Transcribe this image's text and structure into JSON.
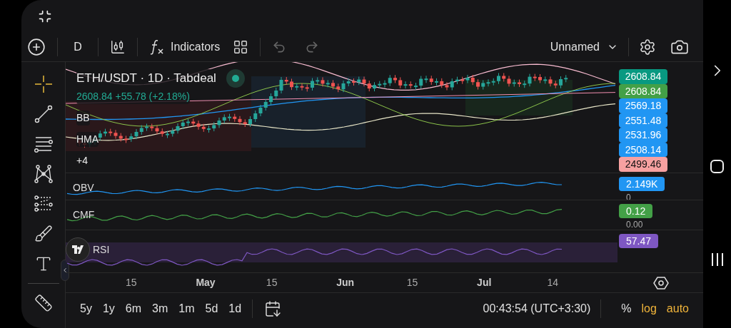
{
  "toolbar": {
    "interval": "D",
    "indicators_label": "Indicators",
    "layout_name": "Unnamed"
  },
  "legend": {
    "symbol": "ETH/USDT · 1D · Tabdeal",
    "quote": "2608.84 +55.78 (+2.18%)",
    "indicators": [
      "BB",
      "HMA",
      "+4"
    ]
  },
  "price_tags": [
    {
      "text": "2608.84",
      "color": "#089981"
    },
    {
      "text": "2608.84",
      "color": "#43a047"
    },
    {
      "text": "2569.18",
      "color": "#2196f3"
    },
    {
      "text": "2551.48",
      "color": "#2196f3"
    },
    {
      "text": "2531.96",
      "color": "#2196f3"
    },
    {
      "text": "2508.14",
      "color": "#2196f3"
    },
    {
      "text": "2499.46",
      "color": "#f7a1a1"
    }
  ],
  "panes": [
    {
      "label": "OBV",
      "value": "2.149K",
      "color": "#2196f3",
      "baseline": "0"
    },
    {
      "label": "CMF",
      "value": "0.12",
      "color": "#43a047",
      "baseline": "0.00"
    },
    {
      "label": "RSI",
      "value": "57.47",
      "color": "#7e57c2"
    }
  ],
  "time_axis": [
    {
      "label": "15",
      "bold": false
    },
    {
      "label": "May",
      "bold": true
    },
    {
      "label": "15",
      "bold": false
    },
    {
      "label": "Jun",
      "bold": true
    },
    {
      "label": "15",
      "bold": false
    },
    {
      "label": "Jul",
      "bold": true
    },
    {
      "label": "14",
      "bold": false
    }
  ],
  "ranges": [
    "5y",
    "1y",
    "6m",
    "3m",
    "1m",
    "5d",
    "1d"
  ],
  "clock": "00:43:54 (UTC+3:30)",
  "scale_options": [
    {
      "label": "%",
      "on": false
    },
    {
      "label": "log",
      "on": true
    },
    {
      "label": "auto",
      "on": true
    }
  ]
}
